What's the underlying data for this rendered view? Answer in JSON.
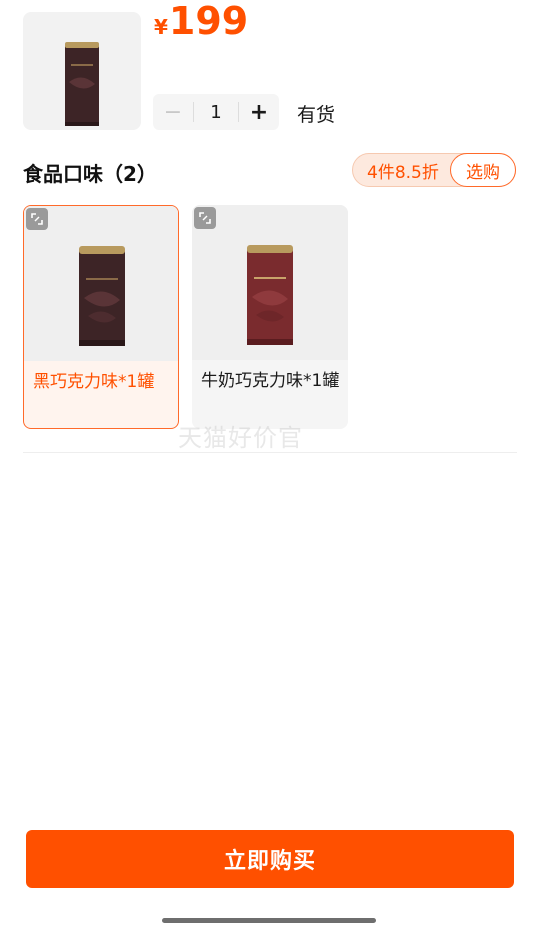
{
  "product": {
    "currency": "¥",
    "price": "199",
    "quantity": "1",
    "minus_symbol": "−",
    "plus_symbol": "+",
    "stock": "有货"
  },
  "section": {
    "title": "食品口味（2）",
    "promo_text": "4件8.5折",
    "promo_button": "选购"
  },
  "options": [
    {
      "label": "黑巧克力味*1罐",
      "selected": true,
      "can_color": "#3d2426"
    },
    {
      "label": "牛奶巧克力味*1罐",
      "selected": false,
      "can_color": "#7a2b2e"
    }
  ],
  "watermark": "天猫好价官",
  "buy_button": "立即购买",
  "colors": {
    "accent": "#ff5000",
    "selected_border": "#ff6a2a",
    "card_bg": "#f5f5f5"
  }
}
